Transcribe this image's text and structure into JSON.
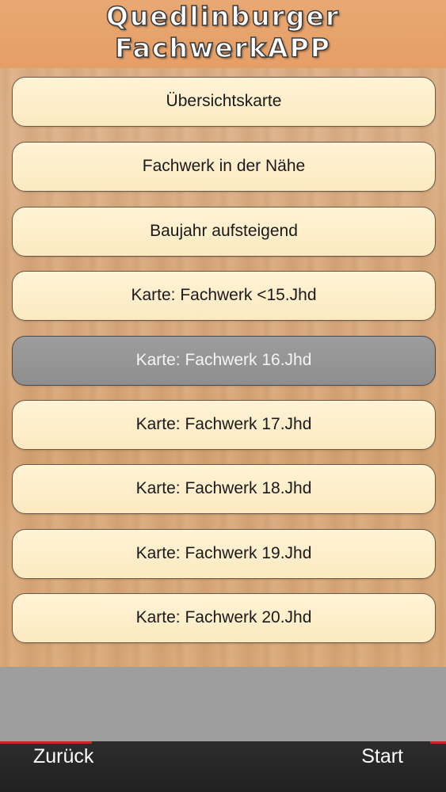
{
  "header": {
    "title_line1": "Quedlinburger",
    "title_line2": "FachwerkAPP"
  },
  "menu": {
    "items": [
      {
        "label": "Übersichtskarte",
        "active": false
      },
      {
        "label": "Fachwerk in der Nähe",
        "active": false
      },
      {
        "label": "Baujahr aufsteigend",
        "active": false
      },
      {
        "label": "Karte: Fachwerk <15.Jhd",
        "active": false
      },
      {
        "label": "Karte: Fachwerk 16.Jhd",
        "active": true
      },
      {
        "label": "Karte: Fachwerk 17.Jhd",
        "active": false
      },
      {
        "label": "Karte: Fachwerk 18.Jhd",
        "active": false
      },
      {
        "label": "Karte: Fachwerk 19.Jhd",
        "active": false
      },
      {
        "label": "Karte: Fachwerk 20.Jhd",
        "active": false
      }
    ]
  },
  "footer": {
    "back_label": "Zurück",
    "start_label": "Start"
  },
  "colors": {
    "header_bg": "#e9a872",
    "button_bg": "#fce9c0",
    "button_active_bg": "#8e8e8e",
    "footer_bg": "#202020",
    "accent": "#c22a2a"
  }
}
